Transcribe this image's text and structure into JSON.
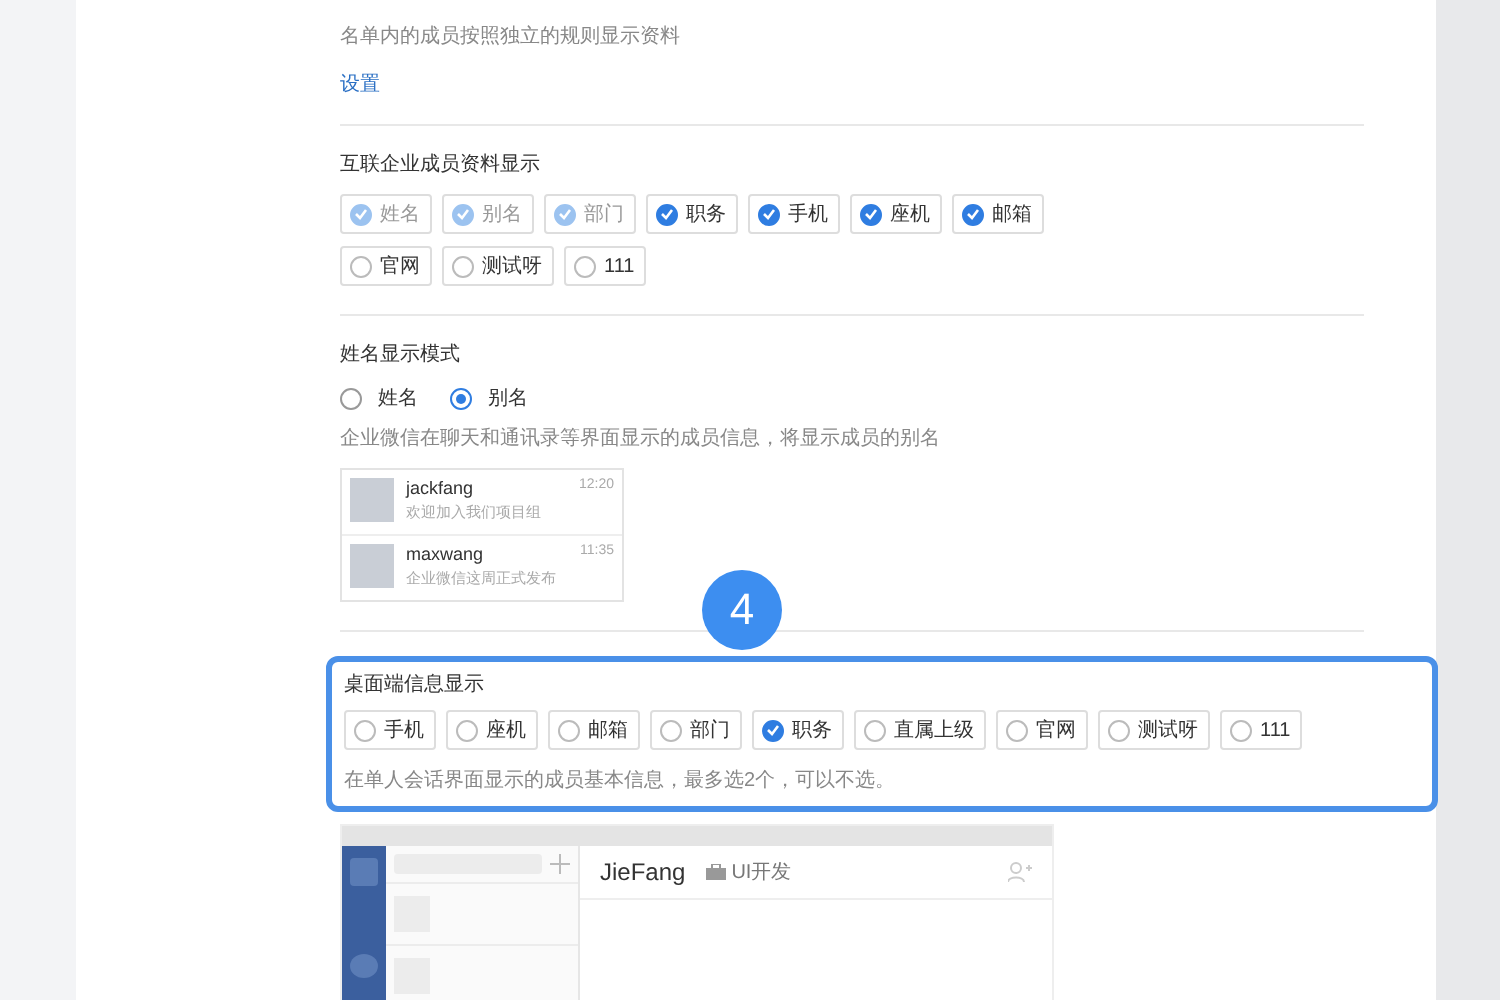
{
  "header": {
    "description": "名单内的成员按照独立的规则显示资料",
    "link": "设置"
  },
  "interconnect": {
    "title": "互联企业成员资料显示",
    "options": [
      {
        "label": "姓名",
        "checked": true,
        "disabled": true
      },
      {
        "label": "别名",
        "checked": true,
        "disabled": true
      },
      {
        "label": "部门",
        "checked": true,
        "disabled": true
      },
      {
        "label": "职务",
        "checked": true,
        "disabled": false
      },
      {
        "label": "手机",
        "checked": true,
        "disabled": false
      },
      {
        "label": "座机",
        "checked": true,
        "disabled": false
      },
      {
        "label": "邮箱",
        "checked": true,
        "disabled": false
      },
      {
        "label": "官网",
        "checked": false,
        "disabled": false
      },
      {
        "label": "测试呀",
        "checked": false,
        "disabled": false
      },
      {
        "label": "111",
        "checked": false,
        "disabled": false
      }
    ]
  },
  "name_mode": {
    "title": "姓名显示模式",
    "options": [
      {
        "label": "姓名",
        "selected": false
      },
      {
        "label": "别名",
        "selected": true
      }
    ],
    "description": "企业微信在聊天和通讯录等界面显示的成员信息，将显示成员的别名",
    "preview": [
      {
        "name": "jackfang",
        "message": "欢迎加入我们项目组",
        "time": "12:20"
      },
      {
        "name": "maxwang",
        "message": "企业微信这周正式发布",
        "time": "11:35"
      }
    ]
  },
  "step_badge": "4",
  "desktop": {
    "title": "桌面端信息显示",
    "highlighted": true,
    "options": [
      {
        "label": "手机",
        "checked": false
      },
      {
        "label": "座机",
        "checked": false
      },
      {
        "label": "邮箱",
        "checked": false
      },
      {
        "label": "部门",
        "checked": false
      },
      {
        "label": "职务",
        "checked": true
      },
      {
        "label": "直属上级",
        "checked": false
      },
      {
        "label": "官网",
        "checked": false
      },
      {
        "label": "测试呀",
        "checked": false
      },
      {
        "label": "111",
        "checked": false
      }
    ],
    "note": "在单人会话界面显示的成员基本信息，最多选2个，可以不选。",
    "preview": {
      "name": "JieFang",
      "department": "UI开发"
    }
  }
}
